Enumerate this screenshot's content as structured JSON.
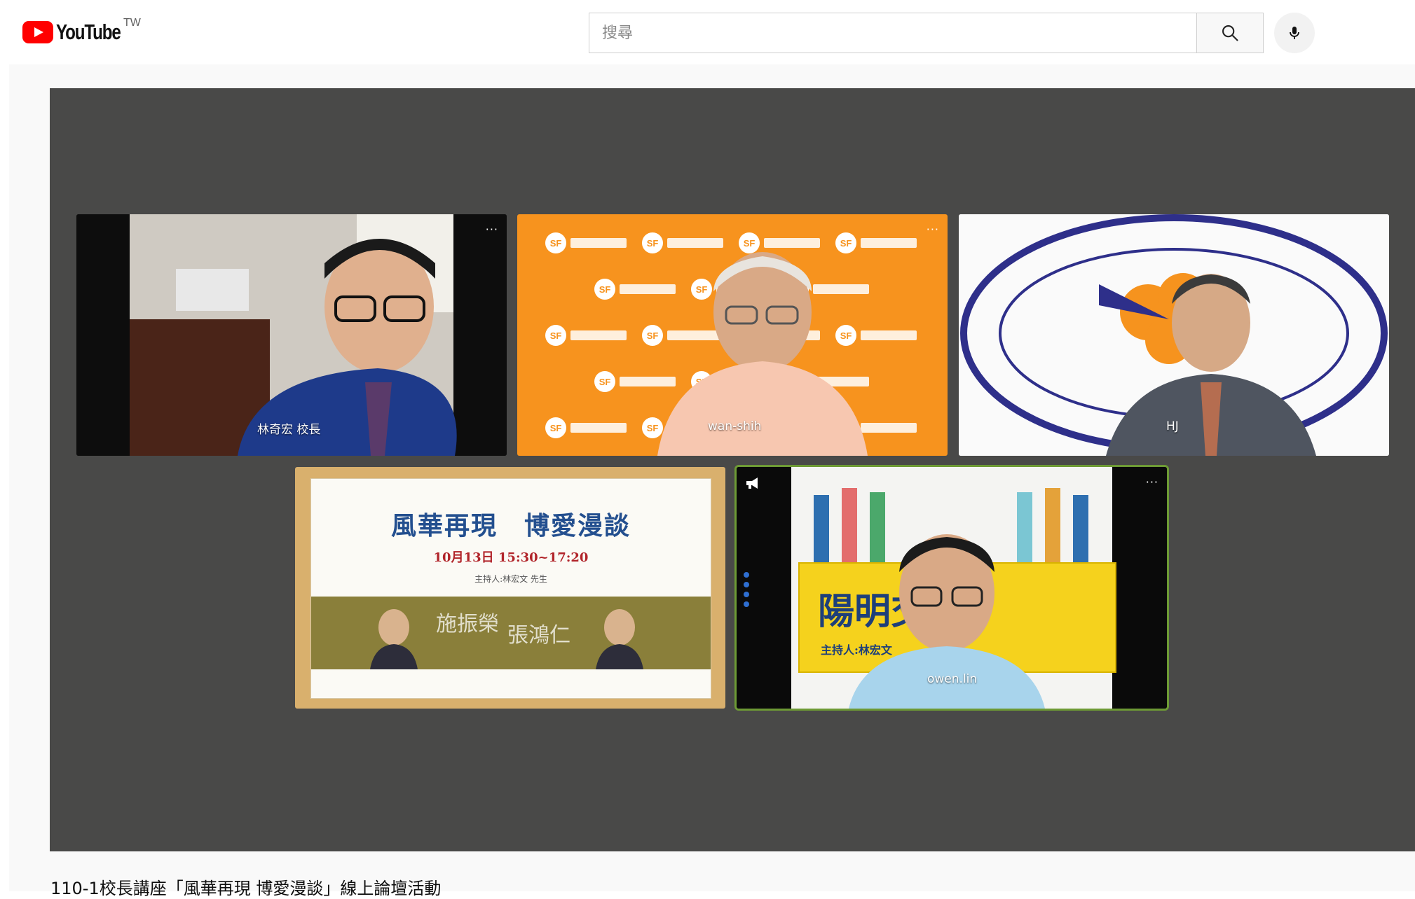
{
  "header": {
    "logo_text": "YouTube",
    "region": "TW",
    "search_placeholder": "搜尋"
  },
  "meeting": {
    "participants": [
      {
        "name": "林奇宏 校長"
      },
      {
        "name": "wan-shih"
      },
      {
        "name": "HJ"
      },
      {
        "name": ""
      },
      {
        "name": "owen.lin"
      }
    ],
    "poster": {
      "title": "風華再現　博愛漫談",
      "datetime": "10月13日 15:30~17:20",
      "host": "主持人:林宏文 先生",
      "speaker_1": "施振榮",
      "speaker_2": "張鴻仁"
    },
    "banner": {
      "text": "陽明交",
      "host": "主持人:林宏文"
    }
  },
  "video": {
    "title": "110-1校長講座「風華再現 博愛漫談」線上論壇活動"
  },
  "colors": {
    "brand_red": "#ff0000",
    "player_bg": "#494948",
    "orange_bg": "#f7931e",
    "active_speaker_border": "#6d9a35"
  }
}
